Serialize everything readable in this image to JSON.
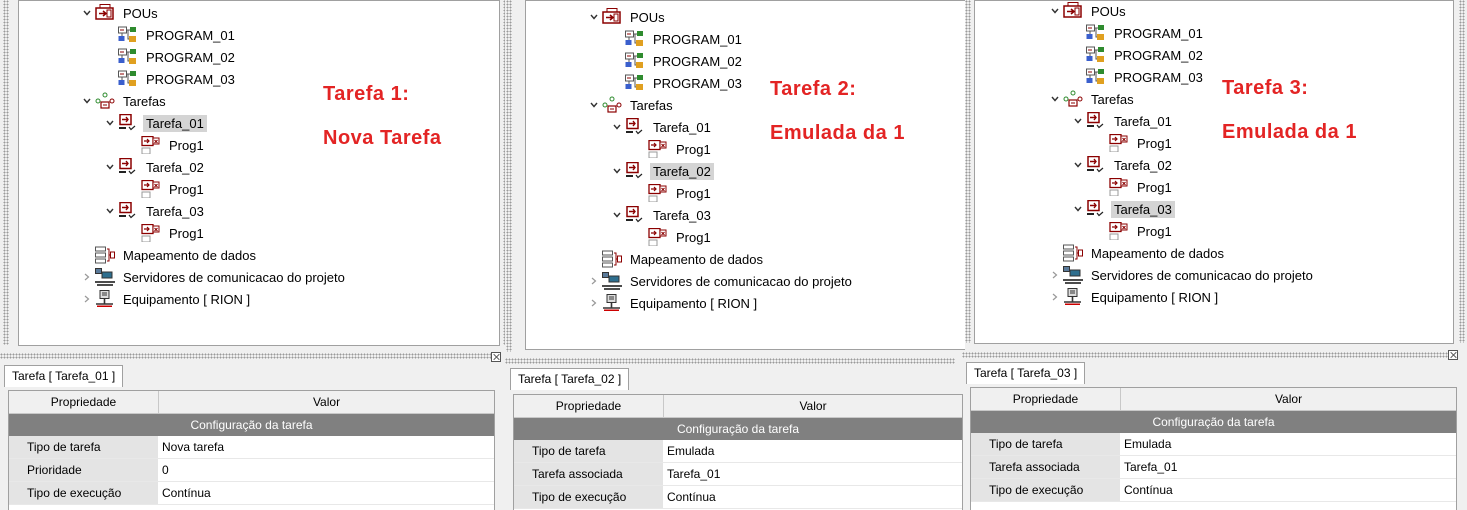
{
  "tree": {
    "pous": "POUs",
    "programs": [
      "PROGRAM_01",
      "PROGRAM_02",
      "PROGRAM_03"
    ],
    "tarefas": "Tarefas",
    "tasks": [
      "Tarefa_01",
      "Tarefa_02",
      "Tarefa_03"
    ],
    "prog": "Prog1",
    "mapeamento": "Mapeamento de dados",
    "servidores": "Servidores de comunicacao do projeto",
    "equipamento": "Equipamento [ RION ]"
  },
  "panels": [
    {
      "annotation": [
        "Tarefa 1:",
        "Nova Tarefa"
      ],
      "tab": "Tarefa [ Tarefa_01 ]",
      "selected": 0,
      "rows": [
        {
          "k": "Tipo de tarefa",
          "v": "Nova tarefa"
        },
        {
          "k": "Prioridade",
          "v": "0"
        },
        {
          "k": "Tipo de execução",
          "v": "Contínua"
        }
      ]
    },
    {
      "annotation": [
        "Tarefa 2:",
        "Emulada da 1"
      ],
      "tab": "Tarefa [ Tarefa_02 ]",
      "selected": 1,
      "rows": [
        {
          "k": "Tipo de tarefa",
          "v": "Emulada"
        },
        {
          "k": "Tarefa associada",
          "v": "Tarefa_01"
        },
        {
          "k": "Tipo de execução",
          "v": "Contínua"
        }
      ]
    },
    {
      "annotation": [
        "Tarefa 3:",
        "Emulada da 1"
      ],
      "tab": "Tarefa [ Tarefa_03 ]",
      "selected": 2,
      "rows": [
        {
          "k": "Tipo de tarefa",
          "v": "Emulada"
        },
        {
          "k": "Tarefa associada",
          "v": "Tarefa_01"
        },
        {
          "k": "Tipo de execução",
          "v": "Contínua"
        }
      ]
    }
  ],
  "grid": {
    "col_prop": "Propriedade",
    "col_val": "Valor",
    "section": "Configuração da tarefa"
  },
  "colors": {
    "annotation": "#e32424",
    "selection": "#d4d4d4",
    "section": "#808080"
  }
}
